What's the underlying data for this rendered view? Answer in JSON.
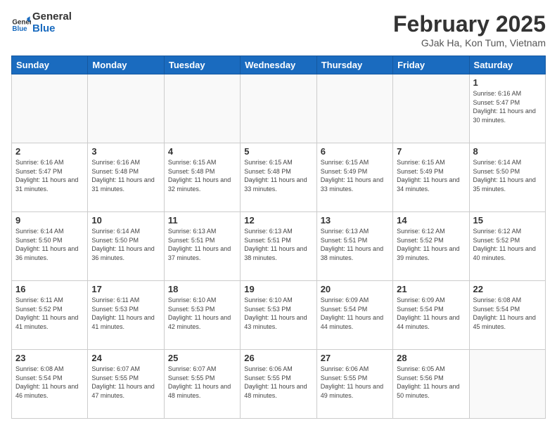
{
  "header": {
    "logo_general": "General",
    "logo_blue": "Blue",
    "month_year": "February 2025",
    "location": "GJak Ha, Kon Tum, Vietnam"
  },
  "days_of_week": [
    "Sunday",
    "Monday",
    "Tuesday",
    "Wednesday",
    "Thursday",
    "Friday",
    "Saturday"
  ],
  "weeks": [
    [
      {
        "day": "",
        "info": ""
      },
      {
        "day": "",
        "info": ""
      },
      {
        "day": "",
        "info": ""
      },
      {
        "day": "",
        "info": ""
      },
      {
        "day": "",
        "info": ""
      },
      {
        "day": "",
        "info": ""
      },
      {
        "day": "1",
        "info": "Sunrise: 6:16 AM\nSunset: 5:47 PM\nDaylight: 11 hours and 30 minutes."
      }
    ],
    [
      {
        "day": "2",
        "info": "Sunrise: 6:16 AM\nSunset: 5:47 PM\nDaylight: 11 hours and 31 minutes."
      },
      {
        "day": "3",
        "info": "Sunrise: 6:16 AM\nSunset: 5:48 PM\nDaylight: 11 hours and 31 minutes."
      },
      {
        "day": "4",
        "info": "Sunrise: 6:15 AM\nSunset: 5:48 PM\nDaylight: 11 hours and 32 minutes."
      },
      {
        "day": "5",
        "info": "Sunrise: 6:15 AM\nSunset: 5:48 PM\nDaylight: 11 hours and 33 minutes."
      },
      {
        "day": "6",
        "info": "Sunrise: 6:15 AM\nSunset: 5:49 PM\nDaylight: 11 hours and 33 minutes."
      },
      {
        "day": "7",
        "info": "Sunrise: 6:15 AM\nSunset: 5:49 PM\nDaylight: 11 hours and 34 minutes."
      },
      {
        "day": "8",
        "info": "Sunrise: 6:14 AM\nSunset: 5:50 PM\nDaylight: 11 hours and 35 minutes."
      }
    ],
    [
      {
        "day": "9",
        "info": "Sunrise: 6:14 AM\nSunset: 5:50 PM\nDaylight: 11 hours and 36 minutes."
      },
      {
        "day": "10",
        "info": "Sunrise: 6:14 AM\nSunset: 5:50 PM\nDaylight: 11 hours and 36 minutes."
      },
      {
        "day": "11",
        "info": "Sunrise: 6:13 AM\nSunset: 5:51 PM\nDaylight: 11 hours and 37 minutes."
      },
      {
        "day": "12",
        "info": "Sunrise: 6:13 AM\nSunset: 5:51 PM\nDaylight: 11 hours and 38 minutes."
      },
      {
        "day": "13",
        "info": "Sunrise: 6:13 AM\nSunset: 5:51 PM\nDaylight: 11 hours and 38 minutes."
      },
      {
        "day": "14",
        "info": "Sunrise: 6:12 AM\nSunset: 5:52 PM\nDaylight: 11 hours and 39 minutes."
      },
      {
        "day": "15",
        "info": "Sunrise: 6:12 AM\nSunset: 5:52 PM\nDaylight: 11 hours and 40 minutes."
      }
    ],
    [
      {
        "day": "16",
        "info": "Sunrise: 6:11 AM\nSunset: 5:52 PM\nDaylight: 11 hours and 41 minutes."
      },
      {
        "day": "17",
        "info": "Sunrise: 6:11 AM\nSunset: 5:53 PM\nDaylight: 11 hours and 41 minutes."
      },
      {
        "day": "18",
        "info": "Sunrise: 6:10 AM\nSunset: 5:53 PM\nDaylight: 11 hours and 42 minutes."
      },
      {
        "day": "19",
        "info": "Sunrise: 6:10 AM\nSunset: 5:53 PM\nDaylight: 11 hours and 43 minutes."
      },
      {
        "day": "20",
        "info": "Sunrise: 6:09 AM\nSunset: 5:54 PM\nDaylight: 11 hours and 44 minutes."
      },
      {
        "day": "21",
        "info": "Sunrise: 6:09 AM\nSunset: 5:54 PM\nDaylight: 11 hours and 44 minutes."
      },
      {
        "day": "22",
        "info": "Sunrise: 6:08 AM\nSunset: 5:54 PM\nDaylight: 11 hours and 45 minutes."
      }
    ],
    [
      {
        "day": "23",
        "info": "Sunrise: 6:08 AM\nSunset: 5:54 PM\nDaylight: 11 hours and 46 minutes."
      },
      {
        "day": "24",
        "info": "Sunrise: 6:07 AM\nSunset: 5:55 PM\nDaylight: 11 hours and 47 minutes."
      },
      {
        "day": "25",
        "info": "Sunrise: 6:07 AM\nSunset: 5:55 PM\nDaylight: 11 hours and 48 minutes."
      },
      {
        "day": "26",
        "info": "Sunrise: 6:06 AM\nSunset: 5:55 PM\nDaylight: 11 hours and 48 minutes."
      },
      {
        "day": "27",
        "info": "Sunrise: 6:06 AM\nSunset: 5:55 PM\nDaylight: 11 hours and 49 minutes."
      },
      {
        "day": "28",
        "info": "Sunrise: 6:05 AM\nSunset: 5:56 PM\nDaylight: 11 hours and 50 minutes."
      },
      {
        "day": "",
        "info": ""
      }
    ]
  ]
}
